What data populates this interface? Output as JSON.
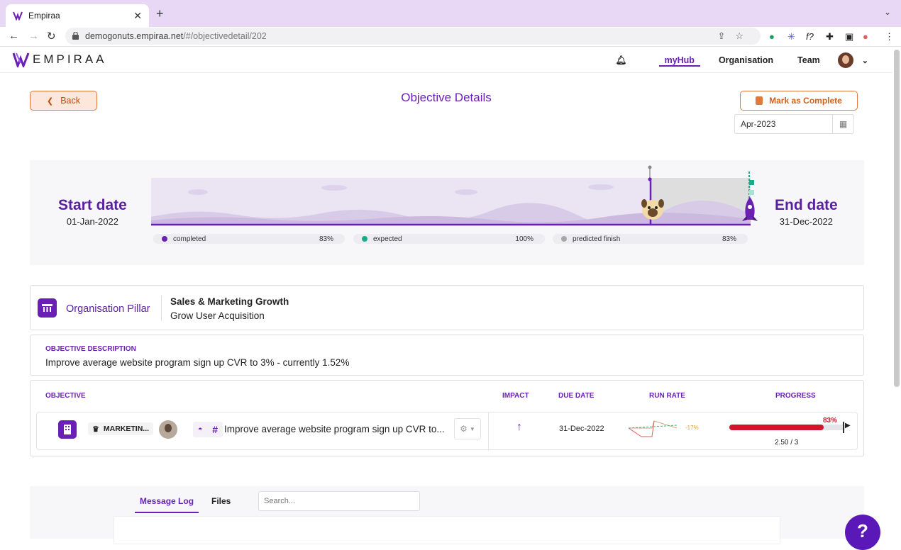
{
  "browser": {
    "tab_title": "Empiraa",
    "url_host": "demogonuts.empiraa.net",
    "url_path": "/#/objectivedetail/202"
  },
  "nav": {
    "logo": "EMPIRAA",
    "links": [
      "myHub",
      "Organisation",
      "Team"
    ]
  },
  "header": {
    "back": "Back",
    "title": "Objective Details",
    "mark_complete": "Mark as Complete",
    "period": "Apr-2023"
  },
  "timeline": {
    "start_label": "Start date",
    "start_date": "01-Jan-2022",
    "end_label": "End date",
    "end_date": "31-Dec-2022",
    "legend": [
      {
        "label": "completed",
        "value": "83%",
        "color": "#6a1fb5"
      },
      {
        "label": "expected",
        "value": "100%",
        "color": "#1aab8a"
      },
      {
        "label": "predicted finish",
        "value": "83%",
        "color": "#a8a8a8"
      }
    ]
  },
  "pillar": {
    "label": "Organisation Pillar",
    "title": "Sales & Marketing Growth",
    "subtitle": "Grow User Acquisition"
  },
  "description": {
    "heading": "OBJECTIVE DESCRIPTION",
    "text": "Improve average website program sign up CVR to 3% - currently 1.52%"
  },
  "objectives": {
    "columns": [
      "OBJECTIVE",
      "IMPACT",
      "DUE DATE",
      "RUN RATE",
      "PROGRESS"
    ],
    "row": {
      "department": "MARKETIN...",
      "title": "Improve average website program sign up CVR to...",
      "due_date": "31-Dec-2022",
      "run_rate": "-17%",
      "progress_pct": "83%",
      "progress_value": 0.83,
      "score": "2.50 / 3"
    }
  },
  "bottom": {
    "tabs": [
      "Message Log",
      "Files"
    ],
    "search_placeholder": "Search..."
  },
  "help": "?"
}
